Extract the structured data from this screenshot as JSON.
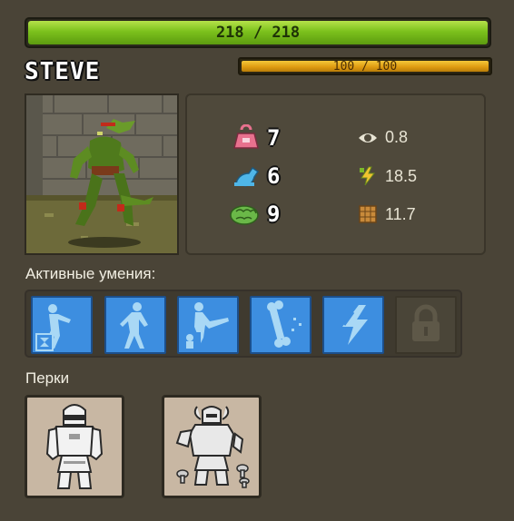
{
  "hero": {
    "name": "STEVE",
    "hp": {
      "text": "218 / 218",
      "fraction": 1.0,
      "color": "#7cc11c"
    },
    "xp": {
      "text": "100 / 100",
      "fraction": 1.0,
      "color": "#e09c12"
    }
  },
  "stats": {
    "primary": [
      {
        "icon": "weight-icon",
        "value": "7",
        "color": "#e8718e"
      },
      {
        "icon": "agility-icon",
        "value": "6",
        "color": "#4fb6e8"
      },
      {
        "icon": "intelligence-icon",
        "value": "9",
        "color": "#6ab848"
      }
    ],
    "secondary": [
      {
        "icon": "eye-icon",
        "value": "0.8"
      },
      {
        "icon": "lightning-icon",
        "value": "18.5"
      },
      {
        "icon": "armor-icon",
        "value": "11.7"
      }
    ]
  },
  "skills": {
    "label": "Активные умения:",
    "items": [
      {
        "icon": "punch-skill-icon",
        "locked": false
      },
      {
        "icon": "stance-skill-icon",
        "locked": false
      },
      {
        "icon": "kick-skill-icon",
        "locked": false
      },
      {
        "icon": "bone-skill-icon",
        "locked": false
      },
      {
        "icon": "lightning-skill-icon",
        "locked": false
      },
      {
        "icon": "lock-icon",
        "locked": true
      }
    ]
  },
  "perks": {
    "label": "Перки",
    "items": [
      {
        "icon": "knight-armor-perk-icon"
      },
      {
        "icon": "horned-warrior-perk-icon"
      }
    ]
  }
}
